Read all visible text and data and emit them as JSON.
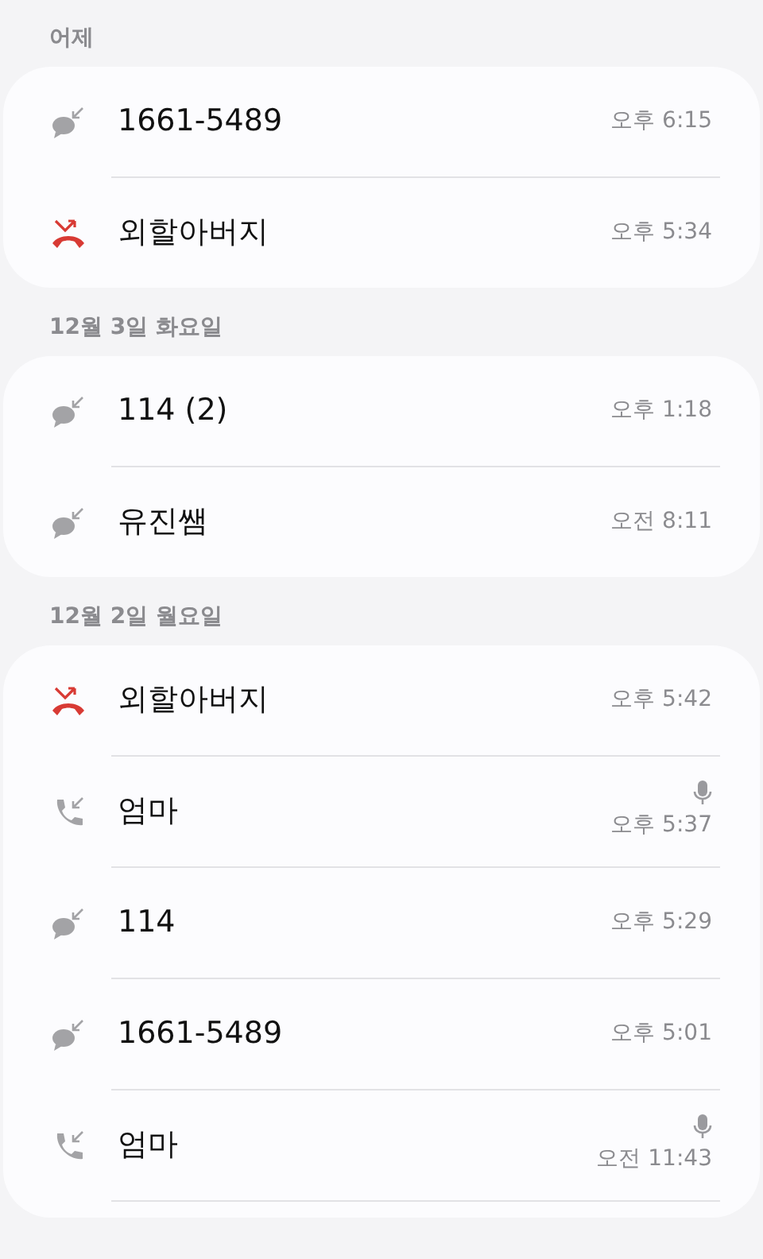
{
  "sections": [
    {
      "date": "어제",
      "calls": [
        {
          "kind": "message",
          "name": "1661-5489",
          "time": "오후 6:15",
          "recorded": false
        },
        {
          "kind": "missed",
          "name": "외할아버지",
          "time": "오후 5:34",
          "recorded": false
        }
      ]
    },
    {
      "date": "12월 3일 화요일",
      "calls": [
        {
          "kind": "message",
          "name": "114 (2)",
          "time": "오후 1:18",
          "recorded": false
        },
        {
          "kind": "message",
          "name": "유진쌤",
          "time": "오전 8:11",
          "recorded": false
        }
      ]
    },
    {
      "date": "12월 2일 월요일",
      "calls": [
        {
          "kind": "missed",
          "name": "외할아버지",
          "time": "오후 5:42",
          "recorded": false
        },
        {
          "kind": "incoming",
          "name": "엄마",
          "time": "오후 5:37",
          "recorded": true
        },
        {
          "kind": "message",
          "name": "114",
          "time": "오후 5:29",
          "recorded": false
        },
        {
          "kind": "message",
          "name": "1661-5489",
          "time": "오후 5:01",
          "recorded": false
        },
        {
          "kind": "incoming",
          "name": "엄마",
          "time": "오전 11:43",
          "recorded": true
        }
      ]
    }
  ]
}
